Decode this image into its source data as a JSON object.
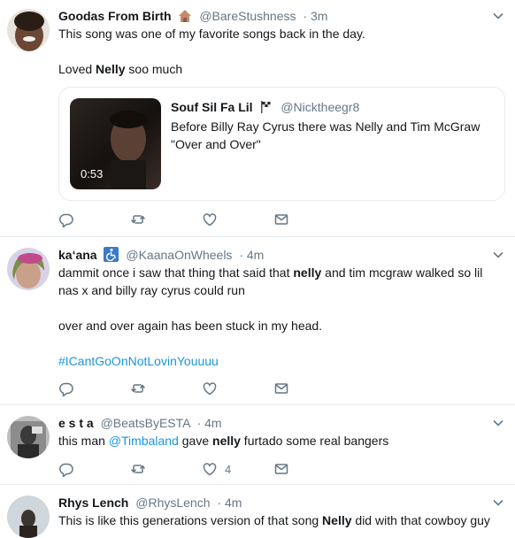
{
  "tweets": [
    {
      "name": "Goodas From Birth",
      "name_emoji": "house-emoji",
      "handle": "@BareStushness",
      "time": "· 3m",
      "lines": [
        [
          {
            "t": "This song was one of my favorite songs back in the day."
          }
        ],
        [],
        [
          {
            "t": "Loved "
          },
          {
            "t": "Nelly",
            "b": true
          },
          {
            "t": " soo much"
          }
        ]
      ],
      "quote": {
        "name": "Souf Sil Fa Lil",
        "name_emoji": "checkered-flag-emoji",
        "handle": "@Nicktheegr8",
        "text_line1": "Before Billy Ray Cyrus there was Nelly and Tim McGraw",
        "text_line2": "\"Over and Over\"",
        "video_duration": "0:53"
      },
      "like_count": ""
    },
    {
      "name": "ka‘ana",
      "name_emoji": "wheelchair-symbol-emoji",
      "handle": "@KaanaOnWheels",
      "time": "· 4m",
      "lines": [
        [
          {
            "t": "dammit once i saw that thing that said that "
          },
          {
            "t": "nelly",
            "b": true
          },
          {
            "t": " and tim mcgraw walked so lil"
          }
        ],
        [
          {
            "t": "nas x and billy ray cyrus could run"
          }
        ],
        [],
        [
          {
            "t": "over and over again has been stuck in my head."
          }
        ],
        [],
        [
          {
            "t": "#ICantGoOnNotLovinYouuuu",
            "link": true
          }
        ]
      ],
      "like_count": ""
    },
    {
      "name": "e s t a",
      "name_emoji": "",
      "handle": "@BeatsByESTA",
      "time": "· 4m",
      "lines": [
        [
          {
            "t": "this man "
          },
          {
            "t": "@Timbaland",
            "link": true
          },
          {
            "t": " gave "
          },
          {
            "t": "nelly",
            "b": true
          },
          {
            "t": " furtado some real bangers"
          }
        ]
      ],
      "like_count": "4"
    },
    {
      "name": "Rhys Lench",
      "name_emoji": "",
      "handle": "@RhysLench",
      "time": "· 4m",
      "lines": [
        [
          {
            "t": "This is like this generations version  of that song "
          },
          {
            "t": "Nelly",
            "b": true
          },
          {
            "t": " did with that cowboy guy"
          }
        ]
      ],
      "like_count": ""
    }
  ],
  "colors": {
    "text": "#14171a",
    "secondary": "#657786",
    "link": "#1b95e0",
    "border": "#e6ecf0"
  },
  "icons": [
    "reply-icon",
    "retweet-icon",
    "like-icon",
    "direct-message-icon",
    "caret-down-icon"
  ]
}
